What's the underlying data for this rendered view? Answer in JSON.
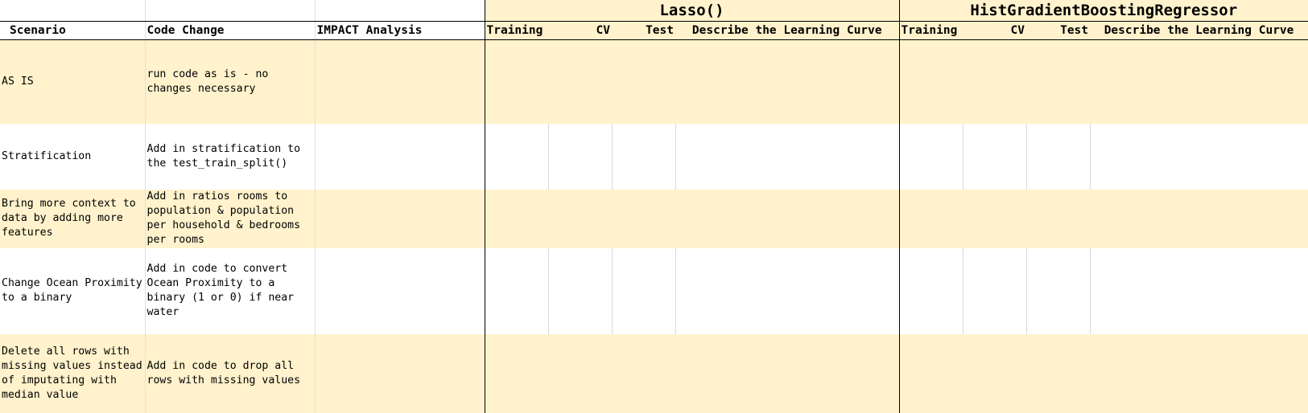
{
  "groups": {
    "lasso": "Lasso()",
    "hgb": "HistGradientBoostingRegressor"
  },
  "headers": {
    "scenario": "Scenario",
    "code_change": "Code Change",
    "impact": "IMPACT Analysis",
    "lasso_training": "Training",
    "lasso_cv": "CV",
    "lasso_test": "Test",
    "lasso_curve": "Describe the Learning Curve",
    "hgb_training": "Training",
    "hgb_cv": "CV",
    "hgb_test": "Test",
    "hgb_curve": "Describe the Learning Curve"
  },
  "rows": [
    {
      "scenario": "AS IS",
      "code_change": "run code as is - no changes necessary"
    },
    {
      "scenario": "Stratification",
      "code_change": "Add in stratification to the test_train_split()"
    },
    {
      "scenario": "Bring more context to data by adding more features",
      "code_change": "Add in ratios rooms to population & population per household & bedrooms per rooms"
    },
    {
      "scenario": "Change Ocean Proximity to a binary",
      "code_change": "Add in code to convert Ocean Proximity to a binary (1 or 0) if near water"
    },
    {
      "scenario": "Delete all rows with missing values instead of imputating with median value",
      "code_change": "Add in code to drop all rows with missing values"
    }
  ]
}
